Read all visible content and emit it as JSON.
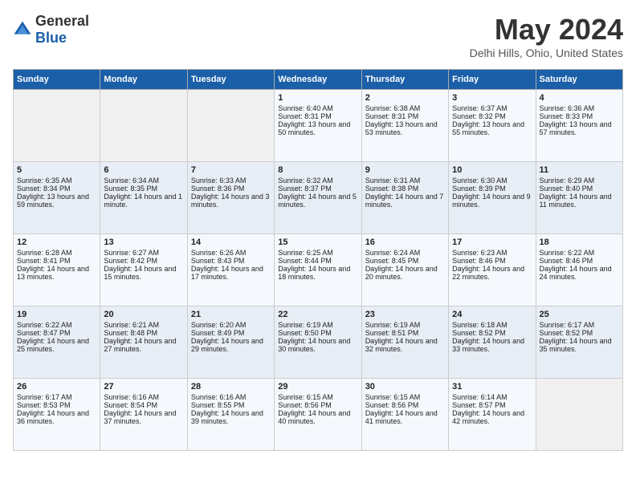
{
  "logo": {
    "general": "General",
    "blue": "Blue"
  },
  "header": {
    "month": "May 2024",
    "location": "Delhi Hills, Ohio, United States"
  },
  "days_of_week": [
    "Sunday",
    "Monday",
    "Tuesday",
    "Wednesday",
    "Thursday",
    "Friday",
    "Saturday"
  ],
  "weeks": [
    [
      {
        "day": "",
        "sunrise": "",
        "sunset": "",
        "daylight": ""
      },
      {
        "day": "",
        "sunrise": "",
        "sunset": "",
        "daylight": ""
      },
      {
        "day": "",
        "sunrise": "",
        "sunset": "",
        "daylight": ""
      },
      {
        "day": "1",
        "sunrise": "Sunrise: 6:40 AM",
        "sunset": "Sunset: 8:31 PM",
        "daylight": "Daylight: 13 hours and 50 minutes."
      },
      {
        "day": "2",
        "sunrise": "Sunrise: 6:38 AM",
        "sunset": "Sunset: 8:31 PM",
        "daylight": "Daylight: 13 hours and 53 minutes."
      },
      {
        "day": "3",
        "sunrise": "Sunrise: 6:37 AM",
        "sunset": "Sunset: 8:32 PM",
        "daylight": "Daylight: 13 hours and 55 minutes."
      },
      {
        "day": "4",
        "sunrise": "Sunrise: 6:36 AM",
        "sunset": "Sunset: 8:33 PM",
        "daylight": "Daylight: 13 hours and 57 minutes."
      }
    ],
    [
      {
        "day": "5",
        "sunrise": "Sunrise: 6:35 AM",
        "sunset": "Sunset: 8:34 PM",
        "daylight": "Daylight: 13 hours and 59 minutes."
      },
      {
        "day": "6",
        "sunrise": "Sunrise: 6:34 AM",
        "sunset": "Sunset: 8:35 PM",
        "daylight": "Daylight: 14 hours and 1 minute."
      },
      {
        "day": "7",
        "sunrise": "Sunrise: 6:33 AM",
        "sunset": "Sunset: 8:36 PM",
        "daylight": "Daylight: 14 hours and 3 minutes."
      },
      {
        "day": "8",
        "sunrise": "Sunrise: 6:32 AM",
        "sunset": "Sunset: 8:37 PM",
        "daylight": "Daylight: 14 hours and 5 minutes."
      },
      {
        "day": "9",
        "sunrise": "Sunrise: 6:31 AM",
        "sunset": "Sunset: 8:38 PM",
        "daylight": "Daylight: 14 hours and 7 minutes."
      },
      {
        "day": "10",
        "sunrise": "Sunrise: 6:30 AM",
        "sunset": "Sunset: 8:39 PM",
        "daylight": "Daylight: 14 hours and 9 minutes."
      },
      {
        "day": "11",
        "sunrise": "Sunrise: 6:29 AM",
        "sunset": "Sunset: 8:40 PM",
        "daylight": "Daylight: 14 hours and 11 minutes."
      }
    ],
    [
      {
        "day": "12",
        "sunrise": "Sunrise: 6:28 AM",
        "sunset": "Sunset: 8:41 PM",
        "daylight": "Daylight: 14 hours and 13 minutes."
      },
      {
        "day": "13",
        "sunrise": "Sunrise: 6:27 AM",
        "sunset": "Sunset: 8:42 PM",
        "daylight": "Daylight: 14 hours and 15 minutes."
      },
      {
        "day": "14",
        "sunrise": "Sunrise: 6:26 AM",
        "sunset": "Sunset: 8:43 PM",
        "daylight": "Daylight: 14 hours and 17 minutes."
      },
      {
        "day": "15",
        "sunrise": "Sunrise: 6:25 AM",
        "sunset": "Sunset: 8:44 PM",
        "daylight": "Daylight: 14 hours and 18 minutes."
      },
      {
        "day": "16",
        "sunrise": "Sunrise: 6:24 AM",
        "sunset": "Sunset: 8:45 PM",
        "daylight": "Daylight: 14 hours and 20 minutes."
      },
      {
        "day": "17",
        "sunrise": "Sunrise: 6:23 AM",
        "sunset": "Sunset: 8:46 PM",
        "daylight": "Daylight: 14 hours and 22 minutes."
      },
      {
        "day": "18",
        "sunrise": "Sunrise: 6:22 AM",
        "sunset": "Sunset: 8:46 PM",
        "daylight": "Daylight: 14 hours and 24 minutes."
      }
    ],
    [
      {
        "day": "19",
        "sunrise": "Sunrise: 6:22 AM",
        "sunset": "Sunset: 8:47 PM",
        "daylight": "Daylight: 14 hours and 25 minutes."
      },
      {
        "day": "20",
        "sunrise": "Sunrise: 6:21 AM",
        "sunset": "Sunset: 8:48 PM",
        "daylight": "Daylight: 14 hours and 27 minutes."
      },
      {
        "day": "21",
        "sunrise": "Sunrise: 6:20 AM",
        "sunset": "Sunset: 8:49 PM",
        "daylight": "Daylight: 14 hours and 29 minutes."
      },
      {
        "day": "22",
        "sunrise": "Sunrise: 6:19 AM",
        "sunset": "Sunset: 8:50 PM",
        "daylight": "Daylight: 14 hours and 30 minutes."
      },
      {
        "day": "23",
        "sunrise": "Sunrise: 6:19 AM",
        "sunset": "Sunset: 8:51 PM",
        "daylight": "Daylight: 14 hours and 32 minutes."
      },
      {
        "day": "24",
        "sunrise": "Sunrise: 6:18 AM",
        "sunset": "Sunset: 8:52 PM",
        "daylight": "Daylight: 14 hours and 33 minutes."
      },
      {
        "day": "25",
        "sunrise": "Sunrise: 6:17 AM",
        "sunset": "Sunset: 8:52 PM",
        "daylight": "Daylight: 14 hours and 35 minutes."
      }
    ],
    [
      {
        "day": "26",
        "sunrise": "Sunrise: 6:17 AM",
        "sunset": "Sunset: 8:53 PM",
        "daylight": "Daylight: 14 hours and 36 minutes."
      },
      {
        "day": "27",
        "sunrise": "Sunrise: 6:16 AM",
        "sunset": "Sunset: 8:54 PM",
        "daylight": "Daylight: 14 hours and 37 minutes."
      },
      {
        "day": "28",
        "sunrise": "Sunrise: 6:16 AM",
        "sunset": "Sunset: 8:55 PM",
        "daylight": "Daylight: 14 hours and 39 minutes."
      },
      {
        "day": "29",
        "sunrise": "Sunrise: 6:15 AM",
        "sunset": "Sunset: 8:56 PM",
        "daylight": "Daylight: 14 hours and 40 minutes."
      },
      {
        "day": "30",
        "sunrise": "Sunrise: 6:15 AM",
        "sunset": "Sunset: 8:56 PM",
        "daylight": "Daylight: 14 hours and 41 minutes."
      },
      {
        "day": "31",
        "sunrise": "Sunrise: 6:14 AM",
        "sunset": "Sunset: 8:57 PM",
        "daylight": "Daylight: 14 hours and 42 minutes."
      },
      {
        "day": "",
        "sunrise": "",
        "sunset": "",
        "daylight": ""
      }
    ]
  ]
}
